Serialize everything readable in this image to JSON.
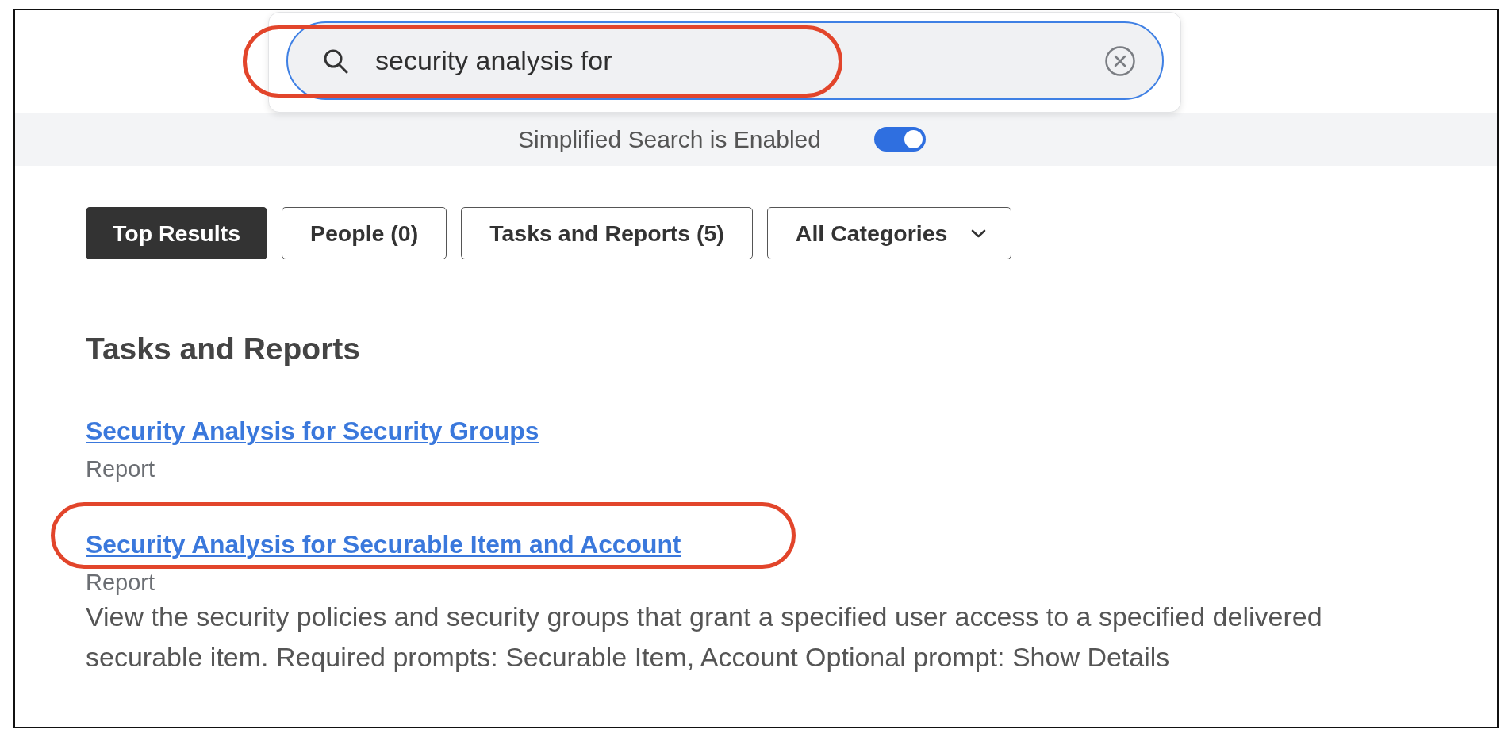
{
  "search": {
    "query": "security analysis for",
    "highlighted": true
  },
  "simplified_search": {
    "label": "Simplified Search is Enabled",
    "on": true
  },
  "tabs": [
    {
      "kind": "tab",
      "label": "Top Results",
      "selected": true
    },
    {
      "kind": "tab",
      "label": "People (0)",
      "selected": false
    },
    {
      "kind": "tab",
      "label": "Tasks and Reports (5)",
      "selected": false
    },
    {
      "kind": "dropdown",
      "label": "All Categories",
      "selected": false
    }
  ],
  "section": {
    "heading": "Tasks and Reports",
    "results": [
      {
        "title": "Security Analysis for Security Groups",
        "type": "Report",
        "highlighted": false
      },
      {
        "title": "Security Analysis for Securable Item and Account",
        "type": "Report",
        "description": "View the security policies and security groups that grant a specified user access to a specified delivered securable item. Required prompts: Securable Item, Account Optional prompt: Show Details",
        "highlighted": true
      }
    ]
  }
}
